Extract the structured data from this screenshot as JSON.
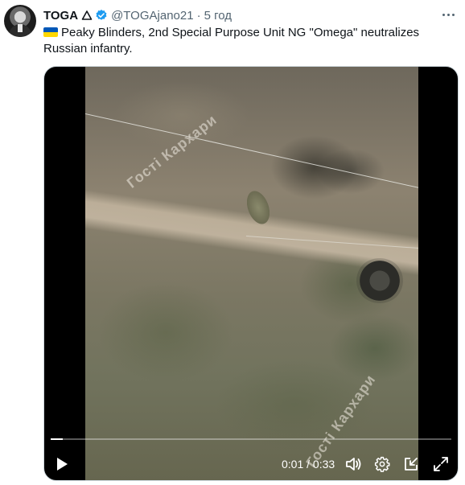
{
  "author": {
    "name": "TOGA",
    "name_symbol": "triangle-outline-icon",
    "verified_badge": "verified-badge-icon",
    "handle": "@TOGAjano21",
    "separator": "·",
    "time": "5 год"
  },
  "tweet": {
    "flag_icon": "ukraine-flag-icon",
    "text": "Peaky Blinders, 2nd Special Purpose Unit NG \"Omega\" neutralizes Russian infantry."
  },
  "video": {
    "watermark_1": "Гостi Кархари",
    "watermark_2": "Гостi Кархари",
    "current_time": "0:01",
    "time_separator": " / ",
    "duration": "0:33",
    "progress_fraction": 0.03
  },
  "colors": {
    "verified_blue": "#1d9bf0",
    "text_primary": "#0f1419",
    "text_secondary": "#536471"
  },
  "icons": {
    "more": "more-dots-icon",
    "play": "play-icon",
    "volume": "volume-icon",
    "settings": "gear-icon",
    "popout": "popout-icon",
    "fullscreen": "fullscreen-icon"
  }
}
